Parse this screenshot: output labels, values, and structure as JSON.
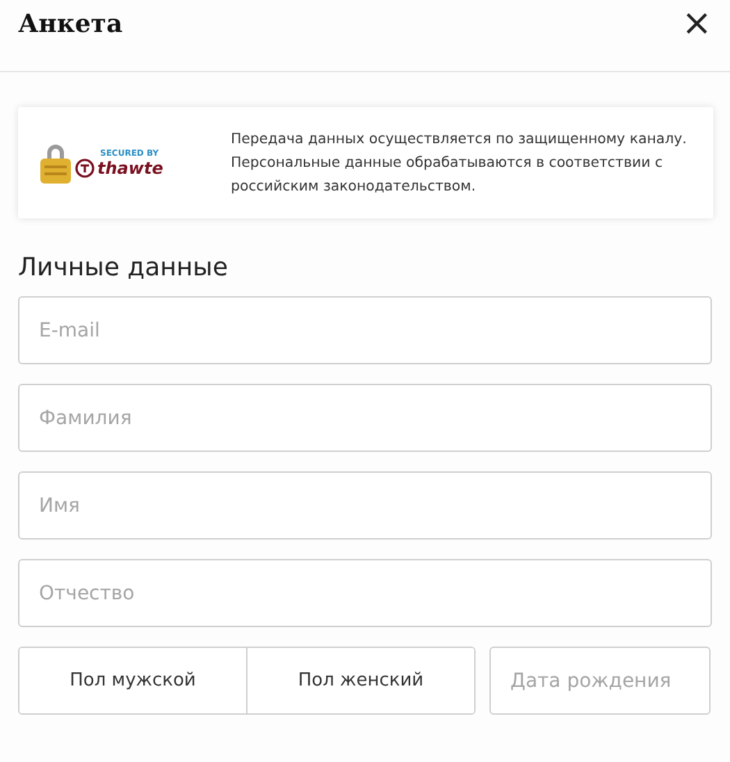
{
  "dialog": {
    "title": "Анкета",
    "close": "×"
  },
  "security_notice": {
    "badge_caption": "SECURED BY",
    "badge_brand": "thawte",
    "text": "Передача данных осуществляется по защищенному каналу. Персональные данные обрабатываются в соответствии с российским законодательством."
  },
  "section": {
    "heading": "Личные данные"
  },
  "fields": [
    {
      "placeholder": "E-mail"
    },
    {
      "placeholder": "Фамилия"
    },
    {
      "placeholder": "Имя"
    },
    {
      "placeholder": "Отчество"
    }
  ],
  "gender_options": [
    {
      "label": "Пол мужской",
      "selected": false
    },
    {
      "label": "Пол женский",
      "selected": false
    }
  ],
  "birth_date": {
    "placeholder": "Дата рождения"
  }
}
